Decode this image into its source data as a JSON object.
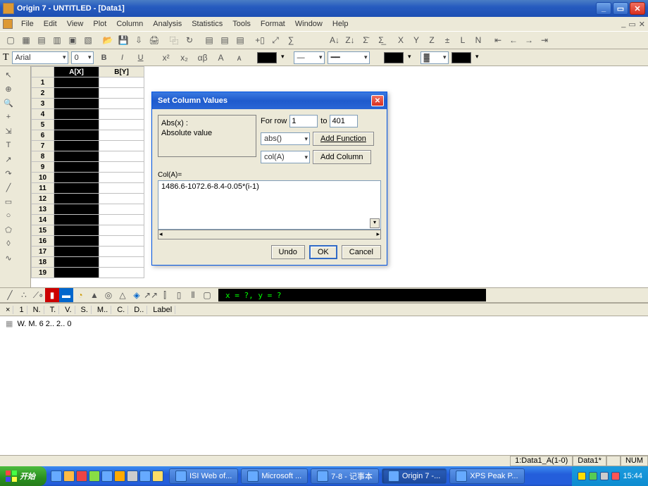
{
  "title": "Origin 7 - UNTITLED - [Data1]",
  "menu": [
    "File",
    "Edit",
    "View",
    "Plot",
    "Column",
    "Analysis",
    "Statistics",
    "Tools",
    "Format",
    "Window",
    "Help"
  ],
  "font": {
    "name": "Arial",
    "size": "0"
  },
  "columns": {
    "a": "A[X]",
    "b": "B[Y]"
  },
  "rows": [
    "1",
    "2",
    "3",
    "4",
    "5",
    "6",
    "7",
    "8",
    "9",
    "10",
    "11",
    "12",
    "13",
    "14",
    "15",
    "16",
    "17",
    "18",
    "19"
  ],
  "dialog": {
    "title": "Set Column Values",
    "desc_line1": "Abs(x) :",
    "desc_line2": "Absolute value",
    "for_row_label": "For row",
    "from_value": "1",
    "to_label": "to",
    "to_value": "401",
    "func_combo": "abs()",
    "add_func_btn": "Add Function",
    "col_combo": "col(A)",
    "add_col_btn": "Add Column",
    "formula_label": "Col(A)=",
    "formula": "1486.6-1072.6-8.4-0.05*(i-1)",
    "undo": "Undo",
    "ok": "OK",
    "cancel": "Cancel"
  },
  "coord_readout": "x = ?, y = ?",
  "panel_tabs": [
    "N.",
    "T.",
    "V.",
    "S.",
    "M..",
    "C.",
    "D..",
    "Label"
  ],
  "panel_row": "W. M. 6 2.. 2.. 0",
  "status": {
    "left": "1:Data1_A(1-0)",
    "mid": "Data1*",
    "right": "NUM"
  },
  "taskbar": {
    "start": "开始",
    "tasks": [
      {
        "label": "ISI Web of..."
      },
      {
        "label": "Microsoft ..."
      },
      {
        "label": "7-8 - 记事本"
      },
      {
        "label": "Origin 7 -...",
        "active": true
      },
      {
        "label": "XPS Peak P..."
      }
    ],
    "clock": "15:44"
  }
}
